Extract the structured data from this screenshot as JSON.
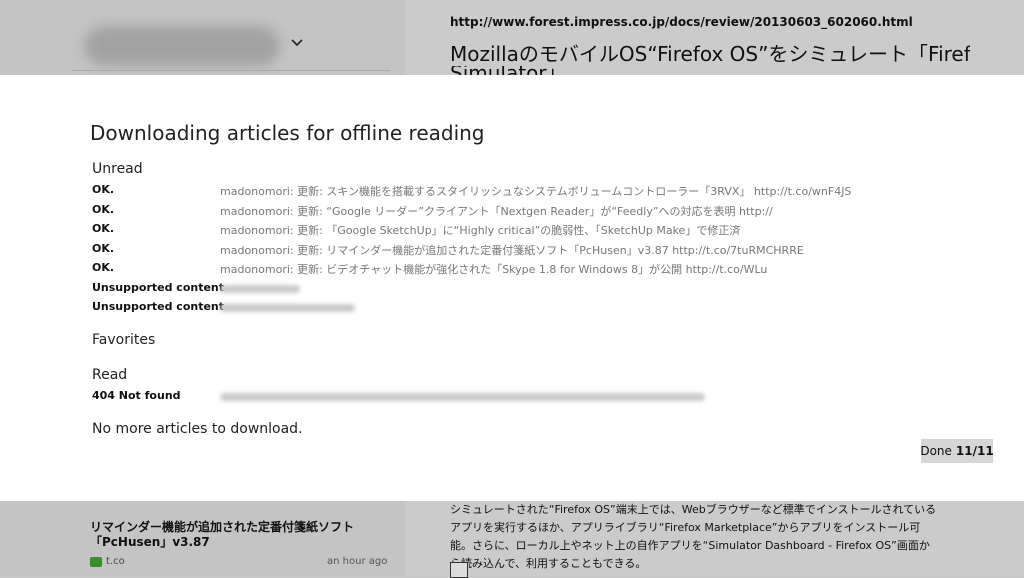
{
  "background": {
    "article_url": "http://www.forest.impress.co.jp/docs/review/20130603_602060.html",
    "article_title": "MozillaのモバイルOS“Firefox OS”をシミュレート「Firefox OS",
    "article_title_cont": "Simulator」",
    "article_body": "シミュレートされた“Firefox OS”端末上では、Webブラウザーなど標準でインストールされているアプリを実行するほか、アプリライブラリ“Firefox Marketplace”からアプリをインストール可能。さらに、ローカル上やネット上の自作アプリを“Simulator Dashboard - Firefox OS”画面から読み込んで、利用することもできる。",
    "list_item": {
      "title": "リマインダー機能が追加された定番付箋紙ソフト「PcHusen」v3.87",
      "source": "t.co",
      "time": "an hour ago"
    }
  },
  "dialog": {
    "title": "Downloading articles for offline reading",
    "sections": {
      "unread": "Unread",
      "favorites": "Favorites",
      "read": "Read"
    },
    "unread_rows": [
      {
        "status": "OK.",
        "message": "madonomori: 更新: スキン機能を搭載するスタイリッシュなシステムボリュームコントローラー「3RVX」 http://t.co/wnF4JS"
      },
      {
        "status": "OK.",
        "message": "madonomori: 更新: “Google リーダー”クライアント「Nextgen Reader」が“Feedly”への対応を表明 http://"
      },
      {
        "status": "OK.",
        "message": "madonomori: 更新: 「Google SketchUp」に“Highly critical”の脆弱性、「SketchUp Make」で修正済"
      },
      {
        "status": "OK.",
        "message": "madonomori: 更新: リマインダー機能が追加された定番付箋紙ソフト「PcHusen」v3.87 http://t.co/7tuRMCHRRE"
      },
      {
        "status": "OK.",
        "message": "madonomori: 更新: ビデオチャット機能が強化された「Skype 1.8 for Windows 8」が公開 http://t.co/WLu"
      },
      {
        "status": "Unsupported content",
        "message": ""
      },
      {
        "status": "Unsupported content",
        "message": ""
      }
    ],
    "read_rows": [
      {
        "status": "404 Not found",
        "message": ""
      }
    ],
    "footer": "No more articles to download.",
    "done_label": "Done",
    "done_count": "11/11"
  }
}
